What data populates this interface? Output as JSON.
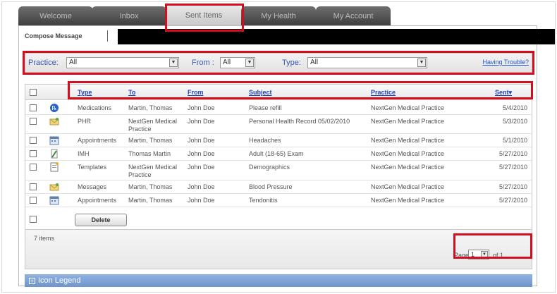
{
  "tabs": [
    "Welcome",
    "Inbox",
    "Sent Items",
    "My Health",
    "My Account"
  ],
  "active_tab": "Sent Items",
  "compose_label": "Compose Message",
  "filters": {
    "practice_label": "Practice:",
    "practice_value": "All",
    "from_label": "From :",
    "from_value": "All",
    "type_label": "Type:",
    "type_value": "All",
    "trouble_link": "Having Trouble?"
  },
  "columns": [
    "Type",
    "To",
    "From",
    "Subject",
    "Practice",
    "Sent"
  ],
  "sort_indicator": "▾",
  "rows": [
    {
      "type": "Medications",
      "to": "Martin, Thomas",
      "from": "John Doe",
      "subject": "Please refill",
      "practice": "NextGen Medical Practice",
      "sent": "5/4/2010",
      "icon": "medication-icon"
    },
    {
      "type": "PHR",
      "to": "NextGen Medical Practice",
      "from": "John Doe",
      "subject": "Personal Health Record 05/02/2010",
      "practice": "NextGen Medical Practice",
      "sent": "5/3/2010",
      "icon": "envelope-icon"
    },
    {
      "type": "Appointments",
      "to": "Martin, Thomas",
      "from": "John Doe",
      "subject": "Headaches",
      "practice": "NextGen Medical Practice",
      "sent": "5/1/2010",
      "icon": "calendar-icon"
    },
    {
      "type": "IMH",
      "to": "Thomas Martin",
      "from": "John Doe",
      "subject": "Adult (18-65) Exam",
      "practice": "NextGen Medical Practice",
      "sent": "5/27/2010",
      "icon": "form-icon"
    },
    {
      "type": "Templates",
      "to": "NextGen Medical Practice",
      "from": "John Doe",
      "subject": "Demographics",
      "practice": "NextGen Medical Practice",
      "sent": "5/27/2010",
      "icon": "template-icon"
    },
    {
      "type": "Messages",
      "to": "Martin, Thomas",
      "from": "John Doe",
      "subject": "Blood Pressure",
      "practice": "NextGen Medical Practice",
      "sent": "5/27/2010",
      "icon": "envelope-icon"
    },
    {
      "type": "Appointments",
      "to": "Martin, Thomas",
      "from": "John Doe",
      "subject": "Tendonitis",
      "practice": "NextGen Medical Practice",
      "sent": "5/27/2010",
      "icon": "calendar-icon"
    }
  ],
  "delete_label": "Delete",
  "items_count": "7 items",
  "pager": {
    "label": "Page",
    "current": "1",
    "of": "of 1"
  },
  "icon_legend": "Icon Legend",
  "highlight_color": "#d10f1f"
}
